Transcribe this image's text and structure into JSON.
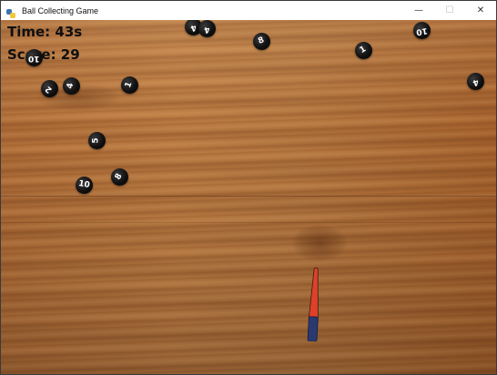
{
  "window": {
    "title": "Ball Collecting Game",
    "app_icon": "python-icon",
    "controls": [
      {
        "name": "minimize-button",
        "glyph": "—"
      },
      {
        "name": "maximize-button",
        "glyph": "☐"
      },
      {
        "name": "close-button",
        "glyph": "✕"
      }
    ]
  },
  "hud": {
    "time_text": "Time: 43s",
    "score_text": "Score: 29"
  },
  "balls": [
    {
      "label": "4",
      "rotation": 160
    },
    {
      "label": "4",
      "rotation": 170
    },
    {
      "label": "8",
      "rotation": -20
    },
    {
      "label": "1",
      "rotation": -30
    },
    {
      "label": "10",
      "rotation": 170
    },
    {
      "label": "10",
      "rotation": 180
    },
    {
      "label": "4",
      "rotation": 160
    },
    {
      "label": "2",
      "rotation": -140
    },
    {
      "label": "4",
      "rotation": -80
    },
    {
      "label": "1",
      "rotation": -70
    },
    {
      "label": "5",
      "rotation": -90
    },
    {
      "label": "8",
      "rotation": -60
    },
    {
      "label": "10",
      "rotation": 10
    }
  ],
  "colors": {
    "ball": "#111111",
    "ball_text": "#ffffff",
    "hud_text": "#0f0f0f",
    "paddle_top": "#e0402a",
    "paddle_bottom": "#2a3a70"
  },
  "paddle": {
    "name": "paddle"
  }
}
